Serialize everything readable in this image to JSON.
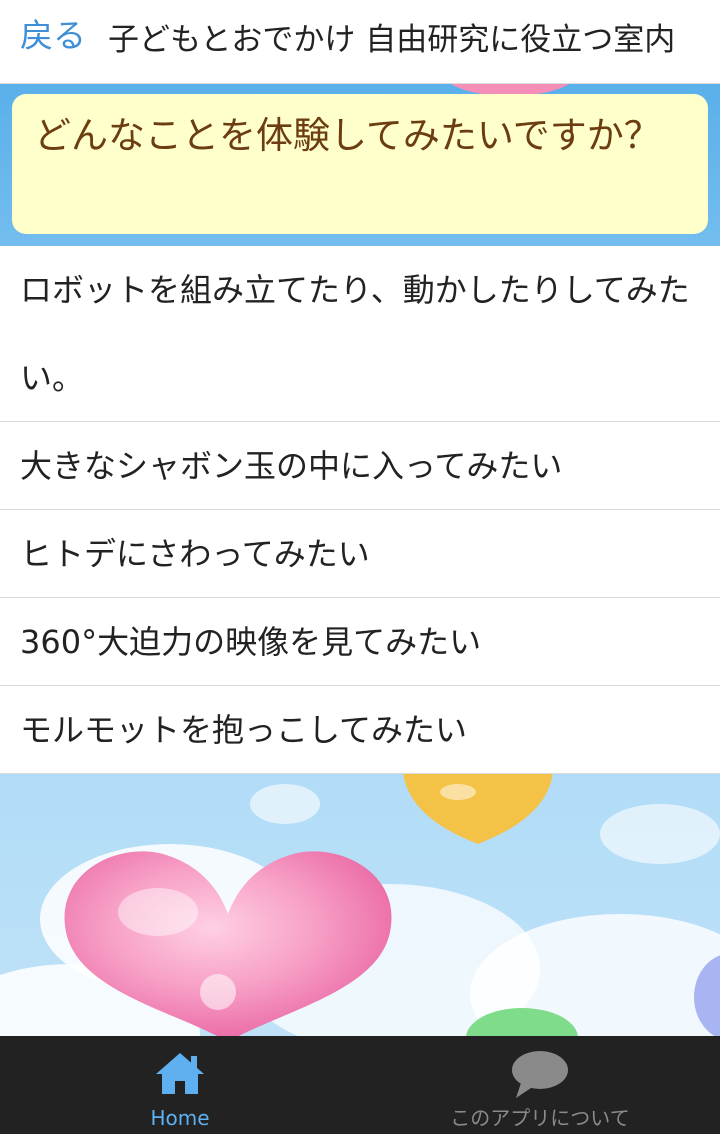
{
  "header": {
    "back_label": "戻る",
    "title": "子どもとおでかけ 自由研究に役立つ室内"
  },
  "question": {
    "text": "どんなことを体験してみたいですか？"
  },
  "answers": [
    {
      "text": "ロボットを組み立てたり、動かしたりしてみたい。"
    },
    {
      "text": "大きなシャボン玉の中に入ってみたい"
    },
    {
      "text": "ヒトデにさわってみたい"
    },
    {
      "text": "360°大迫力の映像を見てみたい"
    },
    {
      "text": "モルモットを抱っこしてみたい"
    }
  ],
  "bottom_nav": {
    "items": [
      {
        "label": "Home",
        "icon": "home-icon",
        "active": true
      },
      {
        "label": "このアプリについて",
        "icon": "chat-bubble-icon",
        "active": false
      }
    ]
  },
  "colors": {
    "accent": "#3f8fd6",
    "question_bg": "#ffffcc",
    "question_text": "#6b3d10",
    "nav_bg": "#222222",
    "nav_active": "#5fb0f0",
    "nav_inactive": "#8a8a8a"
  }
}
